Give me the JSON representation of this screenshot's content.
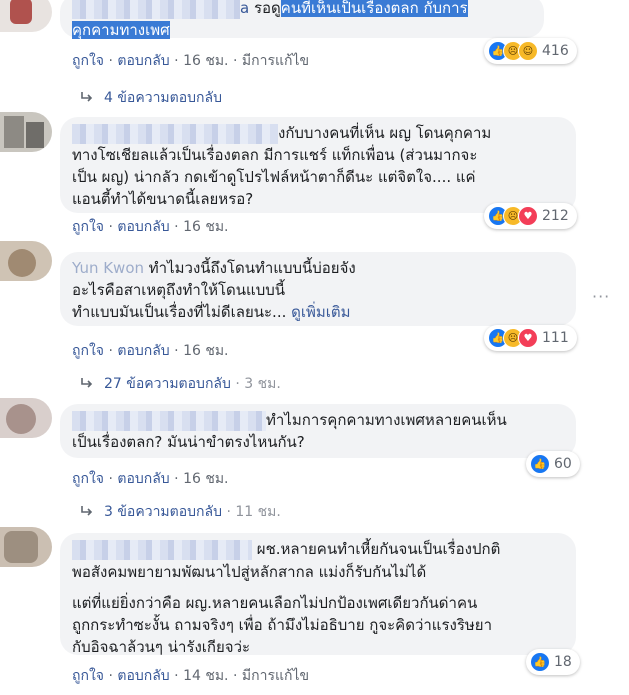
{
  "comments": [
    {
      "line1_name": "a",
      "line1_text": "รอดู",
      "line1_highlight": "คนที่เห็นเป็นเรื่องตลก กับการ",
      "line2_highlight": "คุกคามทางเพศ",
      "like": "ถูกใจ",
      "reply": "ตอบกลับ",
      "time": "16 ชม.",
      "edited": "มีการแก้ไข",
      "reaction_count": "416",
      "reactions": [
        "like-icon",
        "sad-icon",
        "haha-icon"
      ],
      "replies_label": "4 ข้อความตอบกลับ"
    },
    {
      "line1_text": "งกับบางคนที่เห็น ผญ โดนคุกคาม",
      "line2": "ทางโซเชียลแล้วเป็นเรื่องตลก มีการแชร์ แท็กเพื่อน (ส่วนมากจะ",
      "line3": "เป็น ผญ) น่ากลัว กดเข้าดูโปรไฟล์หน้าตาก็ดีนะ แต่จิตใจ.... แค่",
      "line4": "แอนตี้ทำได้ขนาดนี้เลยหรอ?",
      "like": "ถูกใจ",
      "reply": "ตอบกลับ",
      "time": "16 ชม.",
      "reaction_count": "212",
      "reactions": [
        "like-icon",
        "sad-icon",
        "love-icon"
      ]
    },
    {
      "author": "Yun Kwon",
      "line1_text": "ทำไมวงนี้ถึงโดนทำแบบนี้บ่อยจัง",
      "line2": "อะไรคือสาเหตุถึงทำให้โดนแบบนี้",
      "line3": "ทำแบบมันเป็นเรื่องที่ไม่ดีเลยนะ...",
      "see_more": "ดูเพิ่มเติม",
      "like": "ถูกใจ",
      "reply": "ตอบกลับ",
      "time": "16 ชม.",
      "reaction_count": "111",
      "reactions": [
        "like-icon",
        "sad-icon",
        "love-icon"
      ],
      "replies_label": "27 ข้อความตอบกลับ",
      "replies_time": "3 ชม."
    },
    {
      "line1_text": "ทำไมการคุกคามทางเพศหลายคนเห็น",
      "line2": "เป็นเรื่องตลก? มันน่าขำตรงไหนกัน?",
      "like": "ถูกใจ",
      "reply": "ตอบกลับ",
      "time": "16 ชม.",
      "reaction_count": "60",
      "reactions": [
        "like-icon"
      ],
      "replies_label": "3 ข้อความตอบกลับ",
      "replies_time": "11 ชม."
    },
    {
      "line1_text": "ผช.หลายคนทำเหี้ยกันจนเป็นเรื่องปกติ",
      "line2": "พอสังคมพยายามพัฒนาไปสู่หลักสากล แม่งก็รับกันไม่ได้",
      "line3": "แต่ที่แย่ยิ่งกว่าคือ ผญ.หลายคนเลือกไม่ปกป้องเพศเดียวกันด่าคน",
      "line4": "ถูกกระทำซะงั้น ถามจริงๆ เพื่อ ถ้ามึงไม่อธิบาย กูจะคิดว่าแรงริษยา",
      "line5": "กับอิจฉาล้วนๆ น่ารังเกียจว่ะ",
      "like": "ถูกใจ",
      "reply": "ตอบกลับ",
      "time": "14 ชม.",
      "edited": "มีการแก้ไข",
      "reaction_count": "18",
      "reactions": [
        "like-icon"
      ]
    }
  ],
  "dot": "·",
  "more_options": "···"
}
